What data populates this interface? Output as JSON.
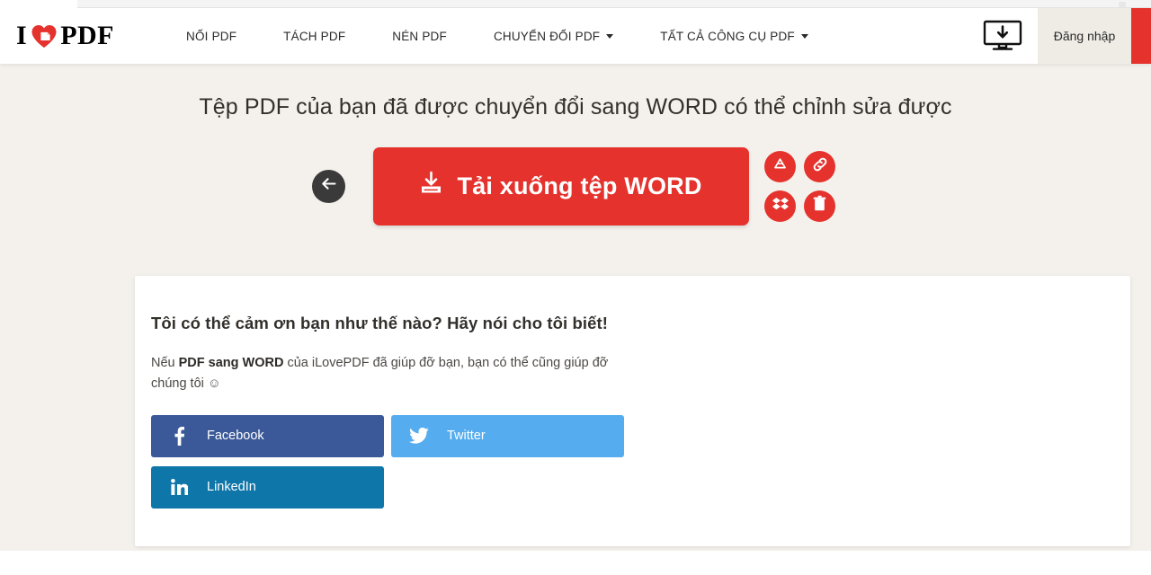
{
  "colors": {
    "brand_red": "#e5322d",
    "page_bg": "#f4f1ec",
    "header_bg": "#ffffff",
    "card_bg": "#ffffff",
    "facebook": "#3b5998",
    "twitter": "#55acee",
    "linkedin": "#0e76a8",
    "back_btn": "#3a3a3a"
  },
  "header": {
    "logo": {
      "text_left": "I",
      "text_right": "PDF",
      "heart_icon": "heart-icon"
    },
    "nav": [
      {
        "label": "NỐI PDF",
        "has_caret": false,
        "name": "nav-merge-pdf"
      },
      {
        "label": "TÁCH PDF",
        "has_caret": false,
        "name": "nav-split-pdf"
      },
      {
        "label": "NÉN PDF",
        "has_caret": false,
        "name": "nav-compress-pdf"
      },
      {
        "label": "CHUYỂN ĐỔI PDF",
        "has_caret": true,
        "name": "nav-convert-pdf"
      },
      {
        "label": "TẤT CẢ CÔNG CỤ PDF",
        "has_caret": true,
        "name": "nav-all-pdf-tools"
      }
    ],
    "desktop_icon": "monitor-download-icon",
    "login_label": "Đăng nhập"
  },
  "hero": {
    "title": "Tệp PDF của bạn đã được chuyển đổi sang WORD có thể chỉnh sửa được",
    "back_icon": "arrow-left-icon",
    "download_label": "Tải xuống tệp WORD",
    "download_icon": "download-icon",
    "side_actions": [
      {
        "icon": "google-drive-icon",
        "name": "save-to-google-drive-button"
      },
      {
        "icon": "link-icon",
        "name": "copy-link-button"
      },
      {
        "icon": "dropbox-icon",
        "name": "save-to-dropbox-button"
      },
      {
        "icon": "trash-icon",
        "name": "delete-file-button"
      }
    ]
  },
  "card": {
    "title": "Tôi có thể cảm ơn bạn như thế nào? Hãy nói cho tôi biết!",
    "desc_part1": "Nếu ",
    "desc_bold": "PDF sang WORD",
    "desc_part2": " của iLovePDF đã giúp đỡ bạn, bạn có thể cũng giúp đỡ chúng tôi ☺",
    "social": [
      {
        "label": "Facebook",
        "icon": "facebook-icon",
        "name": "share-facebook-button"
      },
      {
        "label": "Twitter",
        "icon": "twitter-icon",
        "name": "share-twitter-button"
      },
      {
        "label": "LinkedIn",
        "icon": "linkedin-icon",
        "name": "share-linkedin-button"
      }
    ]
  }
}
